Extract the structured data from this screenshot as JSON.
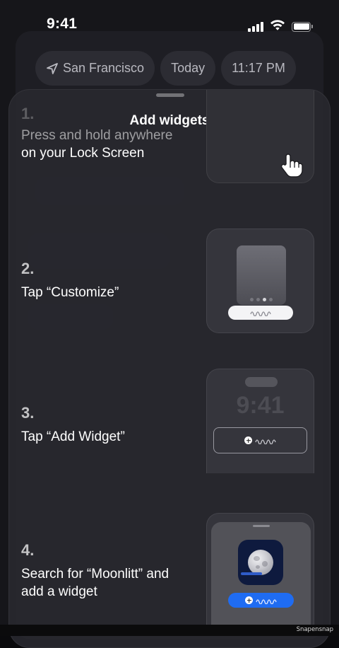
{
  "status_bar": {
    "time": "9:41",
    "icons": [
      "cellular-signal-icon",
      "wifi-icon",
      "battery-icon"
    ]
  },
  "header_chips": {
    "location": "San Francisco",
    "day": "Today",
    "time": "11:17 PM"
  },
  "sheet": {
    "title": "Add widgets",
    "steps": [
      {
        "number": "1.",
        "line1": "Press and hold anywhere",
        "line2": "on your Lock Screen",
        "illustration": "hand-tap-icon"
      },
      {
        "number": "2.",
        "text": "Tap “Customize”",
        "illustration": "customize-preview"
      },
      {
        "number": "3.",
        "text": "Tap “Add Widget”",
        "illustration": "add-widget-preview",
        "preview_time": "9:41"
      },
      {
        "number": "4.",
        "line1": "Search for “Moonlitt” and",
        "line2": "add a widget",
        "illustration": "moonlitt-app-icon"
      }
    ]
  },
  "footer": {
    "watermark": "Snapensnap"
  },
  "colors": {
    "accent_blue": "#1f6cf2",
    "sheet_bg": "#28282e",
    "chip_bg": "#2c2c33"
  }
}
